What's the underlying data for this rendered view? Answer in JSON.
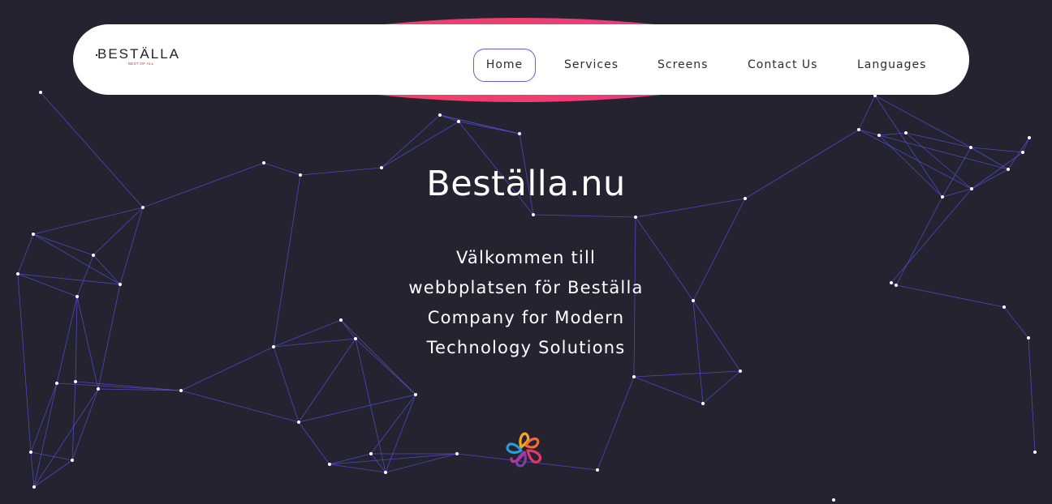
{
  "brand": {
    "name": "BESTÄLLA",
    "tagline": "BEST OF ALL"
  },
  "nav": {
    "items": [
      {
        "label": "Home",
        "active": true
      },
      {
        "label": "Services"
      },
      {
        "label": "Screens"
      },
      {
        "label": "Contact Us"
      },
      {
        "label": "Languages"
      }
    ]
  },
  "hero": {
    "title": "Beställa.nu",
    "subtitle": "Välkommen till webbplatsen för Beställa Company for Modern Technology Solutions"
  },
  "colors": {
    "background": "#24232f",
    "network_line": "#5b4bd6",
    "accent": "#f0425f",
    "active_border": "#6e57e0"
  },
  "icons": {
    "logo_mark": "flower-loop-icon"
  }
}
